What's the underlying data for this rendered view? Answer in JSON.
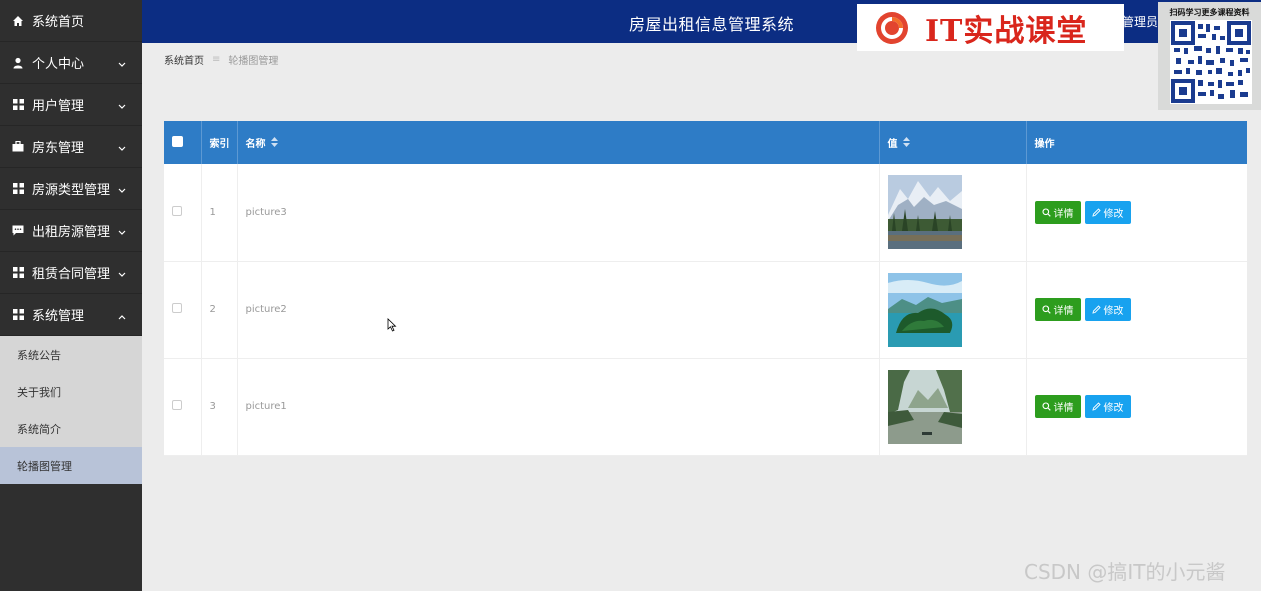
{
  "header": {
    "title": "房屋出租信息管理系统",
    "admin": "管理员",
    "brand_text": "IT实战课堂",
    "qr_caption": "扫码学习更多课程资料"
  },
  "sidebar": {
    "items": [
      {
        "label": "系统首页",
        "icon": "home-icon"
      },
      {
        "label": "个人中心",
        "icon": "user-icon"
      },
      {
        "label": "用户管理",
        "icon": "grid-icon"
      },
      {
        "label": "房东管理",
        "icon": "briefcase-icon"
      },
      {
        "label": "房源类型管理",
        "icon": "grid-icon"
      },
      {
        "label": "出租房源管理",
        "icon": "chat-icon"
      },
      {
        "label": "租赁合同管理",
        "icon": "grid-icon"
      },
      {
        "label": "系统管理",
        "icon": "grid-icon"
      }
    ],
    "submenu": [
      {
        "label": "系统公告"
      },
      {
        "label": "关于我们"
      },
      {
        "label": "系统简介"
      },
      {
        "label": "轮播图管理"
      }
    ]
  },
  "breadcrumb": {
    "home": "系统首页",
    "separator": "≡",
    "current": "轮播图管理"
  },
  "table": {
    "columns": {
      "index": "索引",
      "name": "名称",
      "value": "值",
      "actions": "操作"
    },
    "rows": [
      {
        "index": "1",
        "name": "picture3",
        "image": "snowy-mountain-lake-image"
      },
      {
        "index": "2",
        "name": "picture2",
        "image": "green-island-water-image"
      },
      {
        "index": "3",
        "name": "picture1",
        "image": "river-valley-boat-image"
      }
    ],
    "detail_label": "详情",
    "edit_label": "修改"
  },
  "watermark": "CSDN @搞IT的小元酱",
  "colors": {
    "header": "#0c2d83",
    "sidebar": "#2f2f2f",
    "table_header": "#2e7cc6",
    "detail_button": "#2d9d1e",
    "edit_button": "#18a2ef"
  }
}
